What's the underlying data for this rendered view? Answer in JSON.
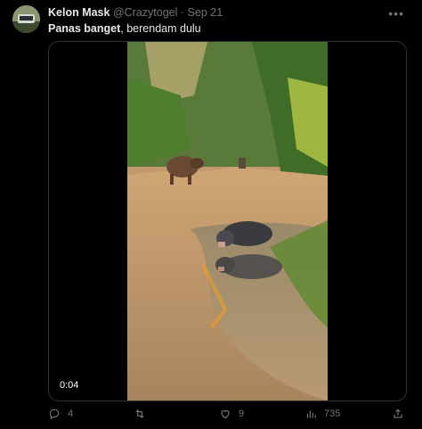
{
  "tweet": {
    "display_name": "Kelon Mask",
    "handle": "@Crazytogel",
    "separator": "·",
    "date": "Sep 21",
    "text_bold": "Panas banget",
    "text_rest": ", berendam dulu"
  },
  "media": {
    "duration": "0:04"
  },
  "actions": {
    "reply_count": "4",
    "retweet_count": "",
    "like_count": "9",
    "view_count": "735"
  },
  "icons": {
    "more": "more-horizontal-icon",
    "reply": "reply-icon",
    "retweet": "retweet-icon",
    "like": "heart-icon",
    "views": "views-icon",
    "share": "share-icon"
  },
  "colors": {
    "background": "#000000",
    "text": "#e7e9ea",
    "muted": "#71767b",
    "border": "#2f3336"
  }
}
